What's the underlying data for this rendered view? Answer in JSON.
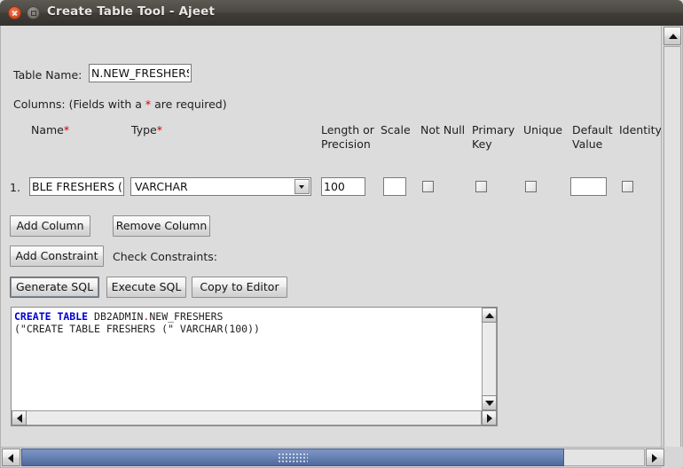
{
  "window": {
    "title": "Create Table Tool - Ajeet",
    "close_icon": "close-icon",
    "maximize_icon": "maximize-icon"
  },
  "form": {
    "table_name_label": "Table Name:",
    "table_name_value": "N.NEW_FRESHERS",
    "columns_note_prefix": "Columns: (Fields with a ",
    "columns_note_star": "*",
    "columns_note_suffix": " are required)"
  },
  "headers": {
    "name": "Name",
    "name_star": "*",
    "type": "Type",
    "type_star": "*",
    "length_line1": "Length or",
    "length_line2": "Precision",
    "scale": "Scale",
    "not_null": "Not Null",
    "primary_key_line1": "Primary",
    "primary_key_line2": "Key",
    "unique": "Unique",
    "default_line1": "Default",
    "default_line2": "Value",
    "identity": "Identity"
  },
  "rows": [
    {
      "index": "1.",
      "name": "BLE FRESHERS (",
      "type": "VARCHAR",
      "length": "100",
      "scale": "",
      "not_null": false,
      "primary_key": false,
      "unique": false,
      "default_value": "",
      "identity": false
    }
  ],
  "buttons": {
    "add_column": "Add Column",
    "remove_column": "Remove Column",
    "add_constraint": "Add Constraint",
    "generate_sql": "Generate SQL",
    "execute_sql": "Execute SQL",
    "copy_to_editor": "Copy to Editor"
  },
  "labels": {
    "check_constraints": "Check Constraints:"
  },
  "sql": {
    "keyword": "CREATE TABLE",
    "schema": "DB2ADMIN",
    "separator": ".",
    "table": "NEW_FRESHERS",
    "line2": "(\"CREATE TABLE FRESHERS (\" VARCHAR(100))"
  },
  "colors": {
    "background": "#dcdcdc",
    "titlebar": "#45423c",
    "required_star": "#d00000",
    "sql_keyword": "#0000d4",
    "scrollbar_thumb": "#6c86b8",
    "close_button": "#e0512a"
  }
}
